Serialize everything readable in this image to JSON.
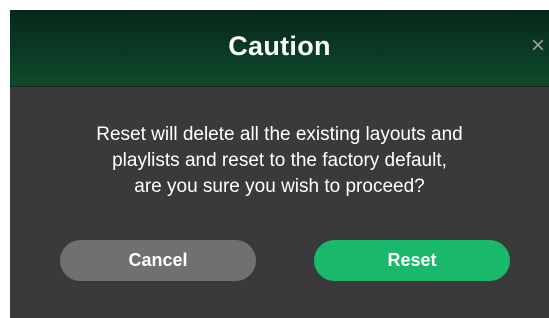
{
  "dialog": {
    "title": "Caution",
    "close_glyph": "×",
    "message_lines": [
      "Reset will delete all the existing layouts and",
      "playlists and reset to the factory default,",
      "are you sure you wish to proceed?"
    ],
    "cancel_label": "Cancel",
    "reset_label": "Reset"
  },
  "colors": {
    "header_green": "#0b3a24",
    "body_gray": "#3a3a3a",
    "cancel_gray": "#707070",
    "reset_green": "#19b86a"
  },
  "icons": {
    "close": "close-icon"
  }
}
